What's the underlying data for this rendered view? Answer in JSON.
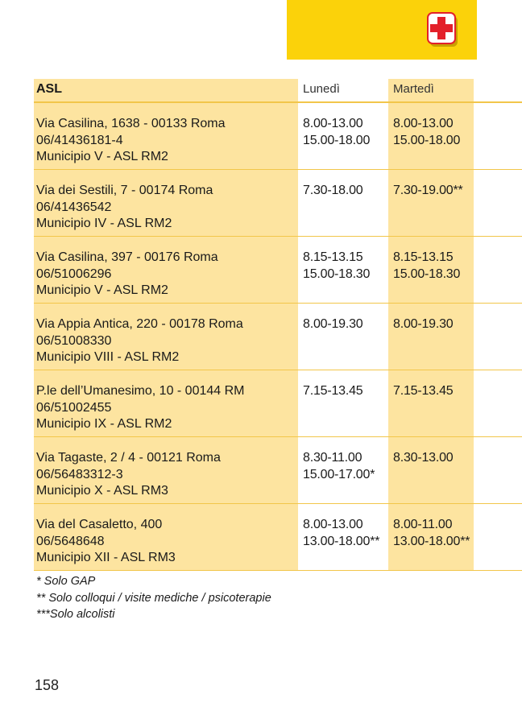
{
  "header": {
    "asl": "ASL",
    "lunedi": "Lunedì",
    "martedi": "Martedì"
  },
  "rows": [
    {
      "address": [
        "Via Casilina, 1638 - 00133 Roma",
        "06/41436181-4",
        "Municipio V - ASL RM2"
      ],
      "lunedi": [
        "8.00-13.00",
        "15.00-18.00"
      ],
      "martedi": [
        "8.00-13.00",
        "15.00-18.00"
      ]
    },
    {
      "address": [
        "Via dei Sestili, 7 - 00174 Roma",
        "06/41436542",
        "Municipio IV - ASL RM2"
      ],
      "lunedi": [
        "7.30-18.00"
      ],
      "martedi": [
        "7.30-19.00**"
      ]
    },
    {
      "address": [
        "Via Casilina, 397 - 00176 Roma",
        "06/51006296",
        "Municipio V - ASL RM2"
      ],
      "lunedi": [
        "8.15-13.15",
        "15.00-18.30"
      ],
      "martedi": [
        "8.15-13.15",
        "15.00-18.30"
      ]
    },
    {
      "address": [
        "Via Appia Antica, 220 - 00178 Roma",
        "06/51008330",
        "Municipio VIII - ASL RM2"
      ],
      "lunedi": [
        "8.00-19.30"
      ],
      "martedi": [
        "8.00-19.30"
      ]
    },
    {
      "address": [
        "P.le dell’Umanesimo, 10 - 00144 RM",
        "06/51002455",
        "Municipio IX - ASL RM2"
      ],
      "lunedi": [
        "7.15-13.45"
      ],
      "martedi": [
        "7.15-13.45"
      ]
    },
    {
      "address": [
        "Via Tagaste, 2 / 4 - 00121 Roma",
        "06/56483312-3",
        "Municipio X - ASL RM3"
      ],
      "lunedi": [
        "8.30-11.00",
        "15.00-17.00*"
      ],
      "martedi": [
        "8.30-13.00"
      ]
    },
    {
      "address": [
        "Via del Casaletto, 400",
        "06/5648648",
        "Municipio XII - ASL RM3"
      ],
      "lunedi": [
        "8.00-13.00",
        "13.00-18.00**"
      ],
      "martedi": [
        "8.00-11.00",
        "13.00-18.00**"
      ]
    }
  ],
  "notes": [
    "* Solo GAP",
    "** Solo colloqui / visite mediche / psicoterapie",
    "***Solo alcolisti"
  ],
  "page_number": "158",
  "icons": {
    "tab_icon": "first-aid-cross-icon"
  },
  "colors": {
    "tab": "#fbd20a",
    "column_fill": "#fde4a0",
    "rule": "#f2c64a",
    "cross": "#e3202a"
  }
}
